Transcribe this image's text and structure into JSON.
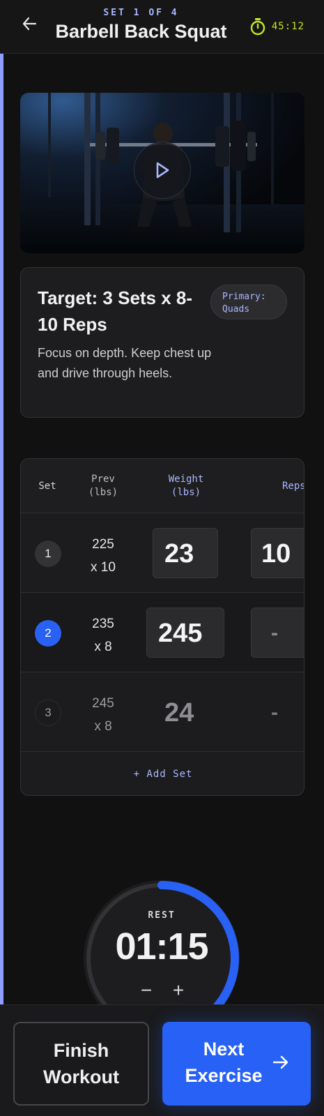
{
  "header": {
    "set_counter": "SET 1 OF 4",
    "title": "Barbell Back Squat",
    "timer": "45:12",
    "accent_color": "#c8e61f"
  },
  "video": {
    "icon": "play-icon"
  },
  "target": {
    "title": "Target: 3 Sets x 8-10 Reps",
    "badge_line1": "Primary:",
    "badge_line2": "Quads",
    "description": "Focus on depth. Keep chest up and drive through heels."
  },
  "sets": {
    "headers": {
      "set": "Set",
      "prev_line1": "Prev",
      "prev_line2": "(lbs)",
      "weight_line1": "Weight",
      "weight_line2": "(lbs)",
      "reps": "Reps"
    },
    "rows": [
      {
        "num": "1",
        "prev_weight": "225",
        "prev_reps": "x 10",
        "weight": "23",
        "reps": "10"
      },
      {
        "num": "2",
        "prev_weight": "235",
        "prev_reps": "x 8",
        "weight": "245",
        "reps": "-"
      },
      {
        "num": "3",
        "prev_weight": "245",
        "prev_reps": "x 8",
        "weight": "24",
        "reps": "-"
      }
    ],
    "add_label": "+ Add Set"
  },
  "rest": {
    "label": "REST",
    "time": "01:15",
    "minus": "−",
    "plus": "+",
    "progress": 0.38,
    "ring_color": "#2a61f5"
  },
  "footer": {
    "finish_line1": "Finish",
    "finish_line2": "Workout",
    "next_line1": "Next",
    "next_line2": "Exercise",
    "next_color": "#2861f5"
  }
}
